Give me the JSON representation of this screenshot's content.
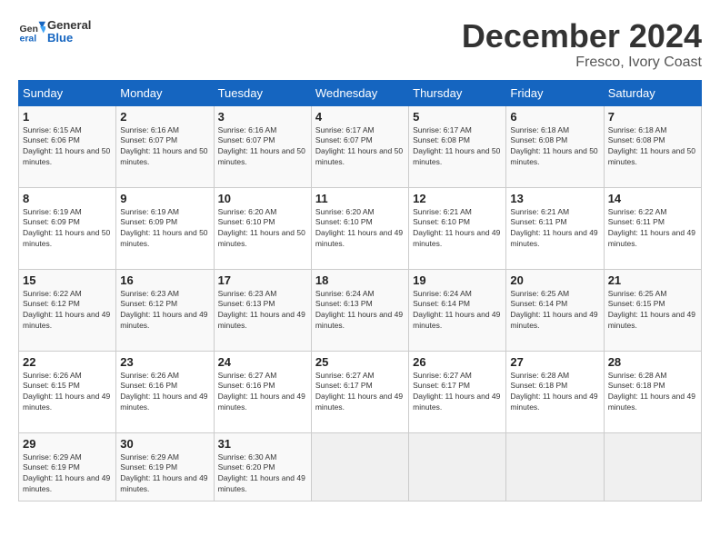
{
  "header": {
    "logo_general": "General",
    "logo_blue": "Blue",
    "month": "December 2024",
    "location": "Fresco, Ivory Coast"
  },
  "weekdays": [
    "Sunday",
    "Monday",
    "Tuesday",
    "Wednesday",
    "Thursday",
    "Friday",
    "Saturday"
  ],
  "weeks": [
    [
      {
        "day": "1",
        "sunrise": "6:15 AM",
        "sunset": "6:06 PM",
        "daylight": "11 hours and 50 minutes."
      },
      {
        "day": "2",
        "sunrise": "6:16 AM",
        "sunset": "6:07 PM",
        "daylight": "11 hours and 50 minutes."
      },
      {
        "day": "3",
        "sunrise": "6:16 AM",
        "sunset": "6:07 PM",
        "daylight": "11 hours and 50 minutes."
      },
      {
        "day": "4",
        "sunrise": "6:17 AM",
        "sunset": "6:07 PM",
        "daylight": "11 hours and 50 minutes."
      },
      {
        "day": "5",
        "sunrise": "6:17 AM",
        "sunset": "6:08 PM",
        "daylight": "11 hours and 50 minutes."
      },
      {
        "day": "6",
        "sunrise": "6:18 AM",
        "sunset": "6:08 PM",
        "daylight": "11 hours and 50 minutes."
      },
      {
        "day": "7",
        "sunrise": "6:18 AM",
        "sunset": "6:08 PM",
        "daylight": "11 hours and 50 minutes."
      }
    ],
    [
      {
        "day": "8",
        "sunrise": "6:19 AM",
        "sunset": "6:09 PM",
        "daylight": "11 hours and 50 minutes."
      },
      {
        "day": "9",
        "sunrise": "6:19 AM",
        "sunset": "6:09 PM",
        "daylight": "11 hours and 50 minutes."
      },
      {
        "day": "10",
        "sunrise": "6:20 AM",
        "sunset": "6:10 PM",
        "daylight": "11 hours and 50 minutes."
      },
      {
        "day": "11",
        "sunrise": "6:20 AM",
        "sunset": "6:10 PM",
        "daylight": "11 hours and 49 minutes."
      },
      {
        "day": "12",
        "sunrise": "6:21 AM",
        "sunset": "6:10 PM",
        "daylight": "11 hours and 49 minutes."
      },
      {
        "day": "13",
        "sunrise": "6:21 AM",
        "sunset": "6:11 PM",
        "daylight": "11 hours and 49 minutes."
      },
      {
        "day": "14",
        "sunrise": "6:22 AM",
        "sunset": "6:11 PM",
        "daylight": "11 hours and 49 minutes."
      }
    ],
    [
      {
        "day": "15",
        "sunrise": "6:22 AM",
        "sunset": "6:12 PM",
        "daylight": "11 hours and 49 minutes."
      },
      {
        "day": "16",
        "sunrise": "6:23 AM",
        "sunset": "6:12 PM",
        "daylight": "11 hours and 49 minutes."
      },
      {
        "day": "17",
        "sunrise": "6:23 AM",
        "sunset": "6:13 PM",
        "daylight": "11 hours and 49 minutes."
      },
      {
        "day": "18",
        "sunrise": "6:24 AM",
        "sunset": "6:13 PM",
        "daylight": "11 hours and 49 minutes."
      },
      {
        "day": "19",
        "sunrise": "6:24 AM",
        "sunset": "6:14 PM",
        "daylight": "11 hours and 49 minutes."
      },
      {
        "day": "20",
        "sunrise": "6:25 AM",
        "sunset": "6:14 PM",
        "daylight": "11 hours and 49 minutes."
      },
      {
        "day": "21",
        "sunrise": "6:25 AM",
        "sunset": "6:15 PM",
        "daylight": "11 hours and 49 minutes."
      }
    ],
    [
      {
        "day": "22",
        "sunrise": "6:26 AM",
        "sunset": "6:15 PM",
        "daylight": "11 hours and 49 minutes."
      },
      {
        "day": "23",
        "sunrise": "6:26 AM",
        "sunset": "6:16 PM",
        "daylight": "11 hours and 49 minutes."
      },
      {
        "day": "24",
        "sunrise": "6:27 AM",
        "sunset": "6:16 PM",
        "daylight": "11 hours and 49 minutes."
      },
      {
        "day": "25",
        "sunrise": "6:27 AM",
        "sunset": "6:17 PM",
        "daylight": "11 hours and 49 minutes."
      },
      {
        "day": "26",
        "sunrise": "6:27 AM",
        "sunset": "6:17 PM",
        "daylight": "11 hours and 49 minutes."
      },
      {
        "day": "27",
        "sunrise": "6:28 AM",
        "sunset": "6:18 PM",
        "daylight": "11 hours and 49 minutes."
      },
      {
        "day": "28",
        "sunrise": "6:28 AM",
        "sunset": "6:18 PM",
        "daylight": "11 hours and 49 minutes."
      }
    ],
    [
      {
        "day": "29",
        "sunrise": "6:29 AM",
        "sunset": "6:19 PM",
        "daylight": "11 hours and 49 minutes."
      },
      {
        "day": "30",
        "sunrise": "6:29 AM",
        "sunset": "6:19 PM",
        "daylight": "11 hours and 49 minutes."
      },
      {
        "day": "31",
        "sunrise": "6:30 AM",
        "sunset": "6:20 PM",
        "daylight": "11 hours and 49 minutes."
      },
      null,
      null,
      null,
      null
    ]
  ]
}
